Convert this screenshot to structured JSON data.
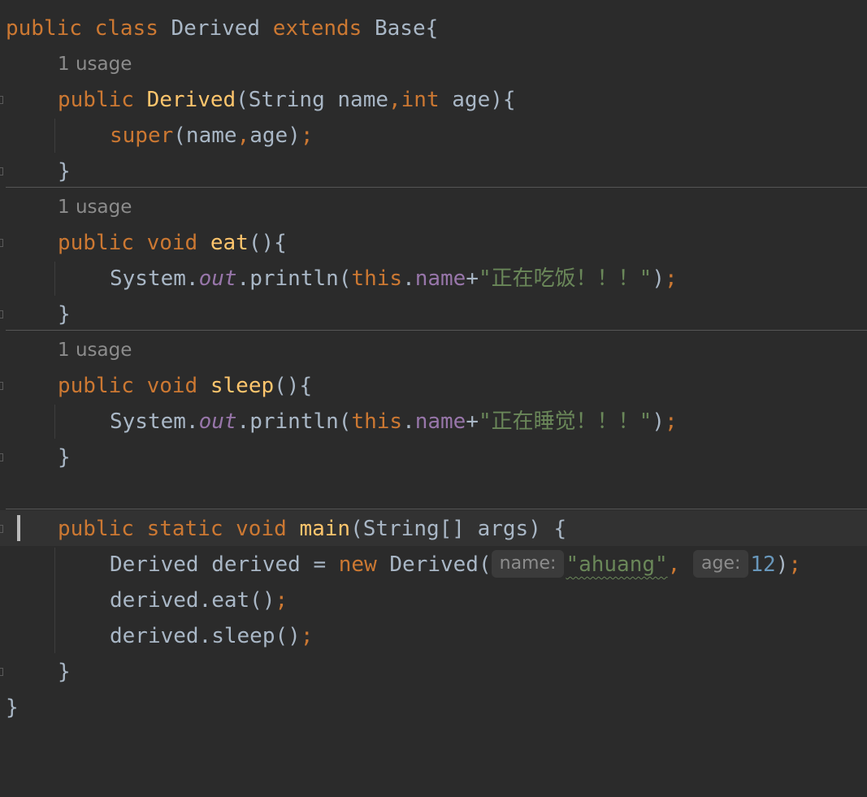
{
  "code": {
    "class_line": {
      "k_public": "public",
      "k_class": "class",
      "name": "Derived",
      "k_extends": "extends",
      "base": "Base{"
    },
    "usage_label": "1 usage",
    "constructor": {
      "k_public": "public",
      "name": "Derived",
      "open": "(String name",
      "comma": ",",
      "k_int": "int",
      "rest": " age){",
      "body_super": "super",
      "body_args": "(name",
      "body_comma": ",",
      "body_args2": "age)",
      "body_semi": ";",
      "close": "}"
    },
    "eat": {
      "k_public": "public",
      "k_void": "void",
      "name": "eat",
      "params": "(){",
      "sys": "System.",
      "out": "out",
      "println": ".println(",
      "k_this": "this",
      "dot": ".",
      "field": "name",
      "plus": "+",
      "str": "\"正在吃饭！！！\"",
      "close_paren": ")",
      "semi": ";",
      "close": "}"
    },
    "sleep": {
      "k_public": "public",
      "k_void": "void",
      "name": "sleep",
      "params": "(){",
      "sys": "System.",
      "out": "out",
      "println": ".println(",
      "k_this": "this",
      "dot": ".",
      "field": "name",
      "plus": "+",
      "str": "\"正在睡觉！！！\"",
      "close_paren": ")",
      "semi": ";",
      "close": "}"
    },
    "main": {
      "k_public": "public",
      "k_static": "static",
      "k_void": "void",
      "name": "main",
      "params": "(String[] args) {",
      "l1_decl": "Derived derived = ",
      "l1_new": "new",
      "l1_ctor": " Derived(",
      "hint_name": "name:",
      "l1_str": "\"ahuang\"",
      "l1_comma": ",",
      "hint_age": "age:",
      "l1_num": "12",
      "l1_close": ")",
      "l1_semi": ";",
      "l2_call": "derived.eat()",
      "l2_semi": ";",
      "l3_call": "derived.sleep()",
      "l3_semi": ";",
      "close": "}"
    },
    "class_close": "}"
  },
  "colors": {
    "background": "#2b2b2b",
    "keyword": "#cc7832",
    "function": "#ffc66d",
    "text": "#a9b7c6",
    "field": "#9876aa",
    "string": "#6a8759",
    "number": "#6897bb",
    "hint": "#8c8c8c"
  }
}
